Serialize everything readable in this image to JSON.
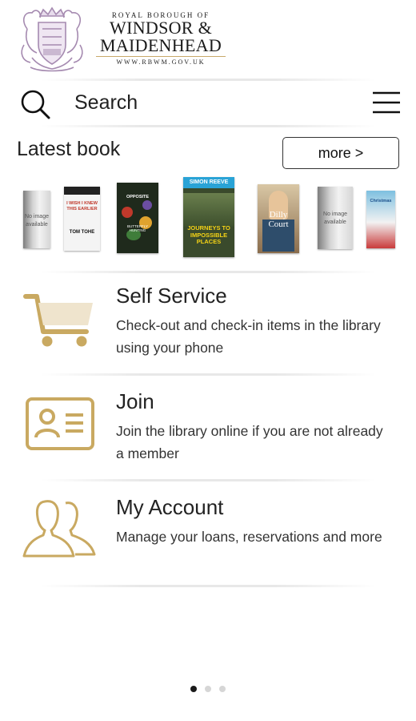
{
  "header": {
    "logo_line1": "ROYAL BOROUGH OF",
    "logo_line2": "WINDSOR &",
    "logo_line3": "MAIDENHEAD",
    "logo_url": "WWW.RBWM.GOV.UK"
  },
  "search": {
    "label": "Search"
  },
  "latest": {
    "title": "Latest book",
    "more_label": "more >",
    "books": [
      {
        "kind": "no-image",
        "text": "No image available"
      },
      {
        "kind": "cover",
        "title": "I WISH I KNEW THIS EARLIER",
        "author": "TOM TOHE"
      },
      {
        "kind": "cover",
        "title": "OPPOSITE",
        "subtitle": "BUTTERFLY HUNTING"
      },
      {
        "kind": "cover",
        "author": "SIMON REEVE",
        "title": "JOURNEYS TO IMPOSSIBLE PLACES"
      },
      {
        "kind": "cover",
        "author": "Dilly Court"
      },
      {
        "kind": "no-image",
        "text": "No image available"
      },
      {
        "kind": "cover",
        "title": "Christmas"
      }
    ]
  },
  "menu": [
    {
      "title": "Self Service",
      "description": "Check-out and check-in items in the library using your phone",
      "icon": "cart-icon"
    },
    {
      "title": "Join",
      "description": "Join the library online if you are not already a member",
      "icon": "id-card-icon"
    },
    {
      "title": "My Account",
      "description": "Manage your loans, reservations and more",
      "icon": "users-icon"
    }
  ],
  "colors": {
    "accent_gold": "#c9a961",
    "logo_purple": "#a58ab0"
  },
  "pager": {
    "count": 3,
    "active": 0
  }
}
